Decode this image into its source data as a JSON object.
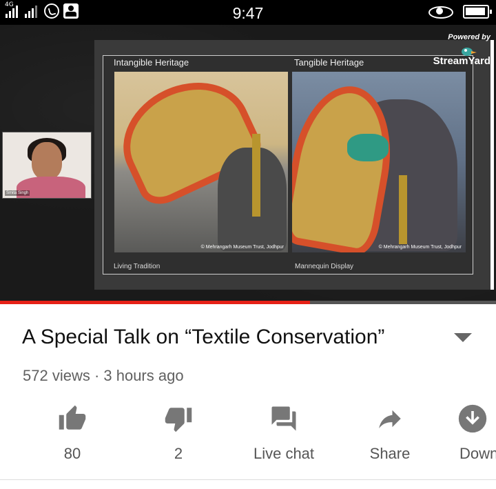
{
  "status_bar": {
    "network_label": "4G",
    "time": "9:47"
  },
  "video": {
    "slide": {
      "left_heading": "Intangible Heritage",
      "right_heading": "Tangible Heritage",
      "left_caption": "Living Tradition",
      "right_caption": "Mannequin Display",
      "left_credit": "© Mehrangarh Museum Trust, Jodhpur",
      "right_credit": "© Mehrangarh Museum Trust, Jodhpur"
    },
    "powered_by": "Powered by",
    "brand": "StreamYard",
    "speaker_name": "Smita Singh",
    "progress": 0.625
  },
  "info": {
    "title": "A Special Talk on  “Textile Conservation”",
    "meta": "572 views · 3 hours ago"
  },
  "actions": [
    {
      "label": "80",
      "icon": "thumbs-up-icon"
    },
    {
      "label": "2",
      "icon": "thumbs-down-icon"
    },
    {
      "label": "Live chat",
      "icon": "live-chat-icon"
    },
    {
      "label": "Share",
      "icon": "share-icon"
    },
    {
      "label": "Down",
      "icon": "download-icon"
    }
  ],
  "colors": {
    "accent": "#e62117",
    "icon_gray": "#777777"
  }
}
